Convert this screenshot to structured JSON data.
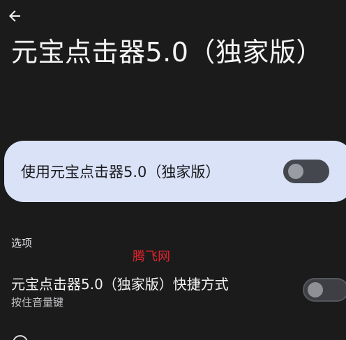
{
  "header": {
    "back_icon": "arrow-left-icon",
    "title": "元宝点击器5.0（独家版）"
  },
  "main_toggle": {
    "label": "使用元宝点击器5.0（独家版）",
    "enabled": false
  },
  "options_section": {
    "header": "选项",
    "shortcut": {
      "title": "元宝点击器5.0（独家版）快捷方式",
      "subtitle": "按住音量键",
      "enabled": false
    }
  },
  "watermark": "腾飞网",
  "colors": {
    "background": "#1b1b1c",
    "card": "#d9e2f7",
    "switch_track_off": "#44474e",
    "watermark": "#e0242c"
  }
}
